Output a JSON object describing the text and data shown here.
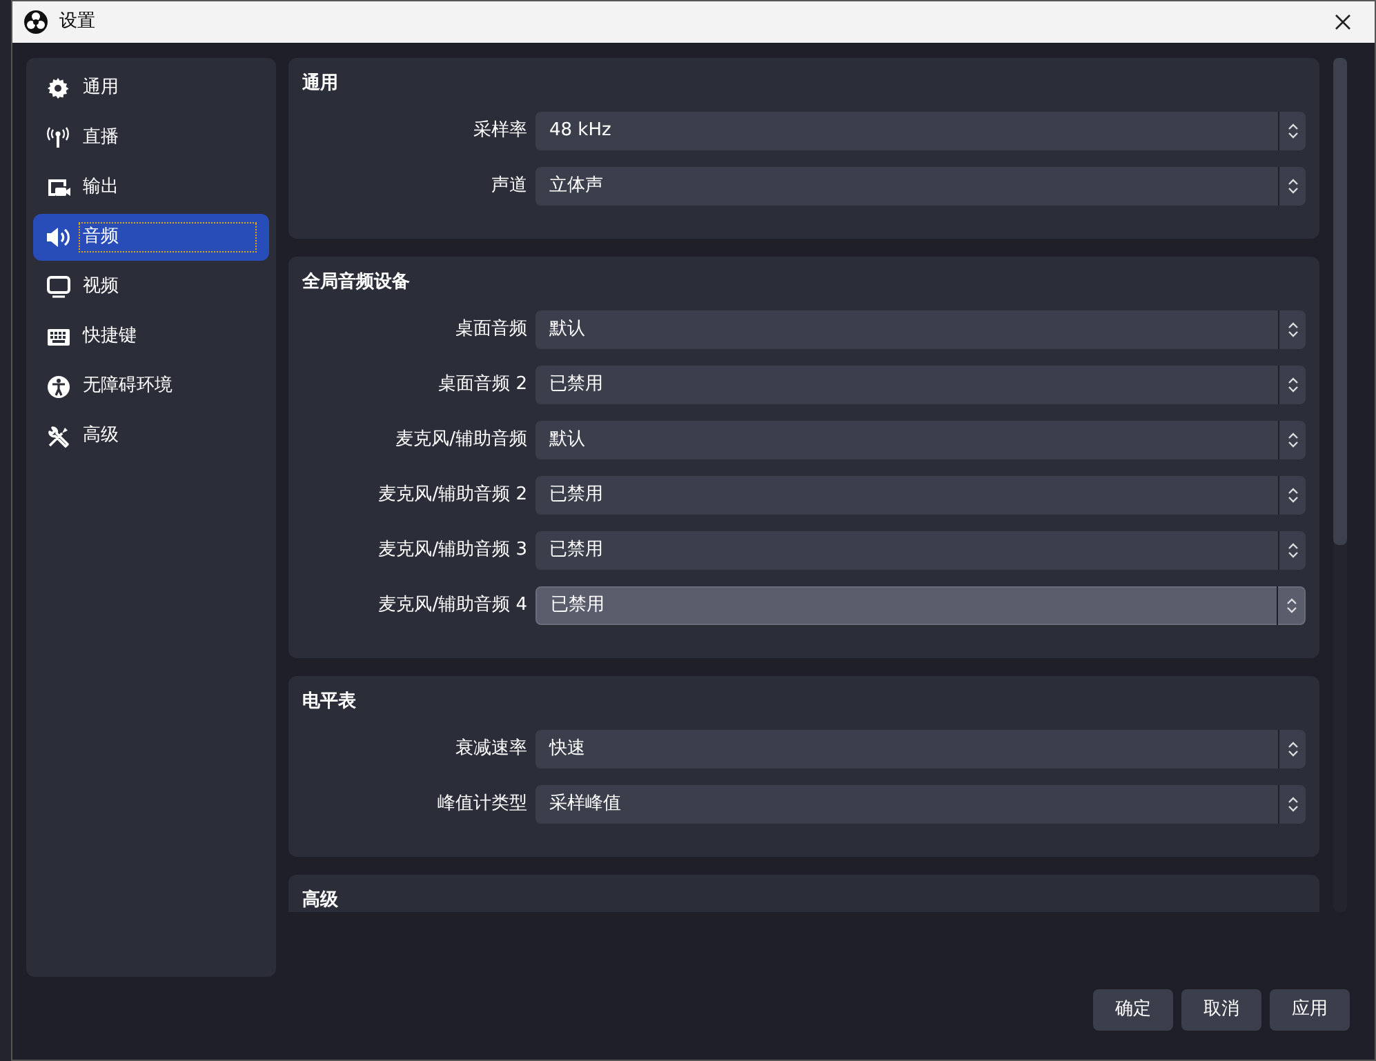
{
  "window": {
    "title": "设置"
  },
  "sidebar": {
    "items": [
      {
        "kind": "gear",
        "label": "通用",
        "selected": false
      },
      {
        "kind": "antenna",
        "label": "直播",
        "selected": false
      },
      {
        "kind": "output",
        "label": "输出",
        "selected": false
      },
      {
        "kind": "speaker",
        "label": "音频",
        "selected": true
      },
      {
        "kind": "monitor",
        "label": "视频",
        "selected": false
      },
      {
        "kind": "keyboard",
        "label": "快捷键",
        "selected": false
      },
      {
        "kind": "accessibility",
        "label": "无障碍环境",
        "selected": false
      },
      {
        "kind": "tools",
        "label": "高级",
        "selected": false
      }
    ]
  },
  "groups": [
    {
      "title": "通用",
      "rows": [
        {
          "label": "采样率",
          "value": "48 kHz",
          "hovered": false
        },
        {
          "label": "声道",
          "value": "立体声",
          "hovered": false
        }
      ]
    },
    {
      "title": "全局音频设备",
      "rows": [
        {
          "label": "桌面音频",
          "value": "默认",
          "hovered": false
        },
        {
          "label": "桌面音频 2",
          "value": "已禁用",
          "hovered": false
        },
        {
          "label": "麦克风/辅助音频",
          "value": "默认",
          "hovered": false
        },
        {
          "label": "麦克风/辅助音频 2",
          "value": "已禁用",
          "hovered": false
        },
        {
          "label": "麦克风/辅助音频 3",
          "value": "已禁用",
          "hovered": false
        },
        {
          "label": "麦克风/辅助音频 4",
          "value": "已禁用",
          "hovered": true
        }
      ]
    },
    {
      "title": "电平表",
      "rows": [
        {
          "label": "衰减速率",
          "value": "快速",
          "hovered": false
        },
        {
          "label": "峰值计类型",
          "value": "采样峰值",
          "hovered": false
        }
      ]
    },
    {
      "title": "高级"
    }
  ],
  "buttons": [
    "确定",
    "取消",
    "应用"
  ]
}
